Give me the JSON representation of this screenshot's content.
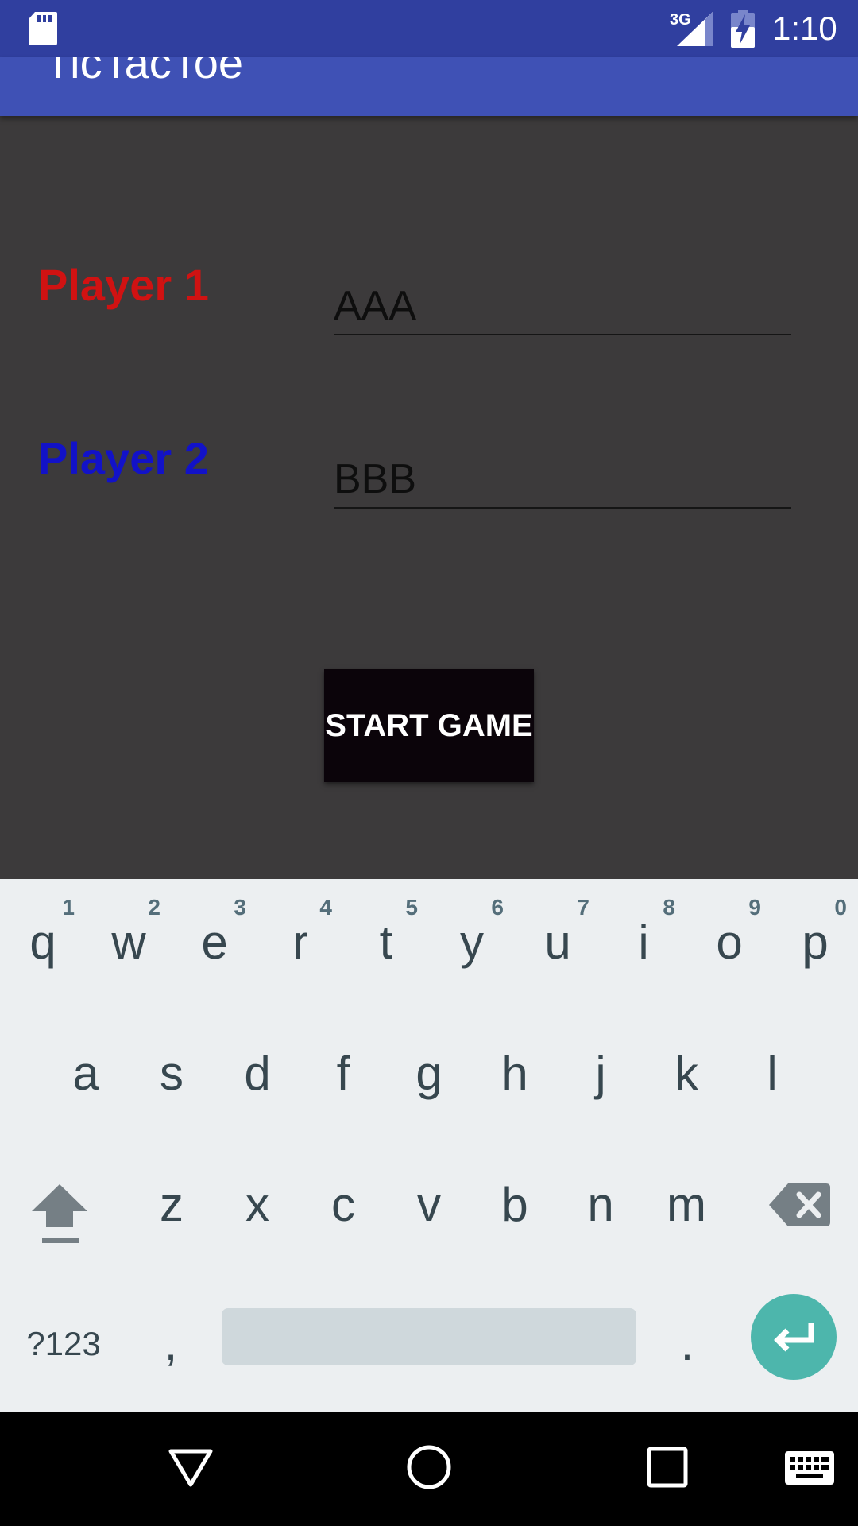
{
  "status_bar": {
    "network_type": "3G",
    "time": "1:10",
    "icons": [
      "sd-card-icon",
      "signal-icon",
      "battery-charging-icon"
    ]
  },
  "app_bar": {
    "title": "TicTacToe"
  },
  "form": {
    "player1": {
      "label": "Player 1",
      "value": "AAA",
      "label_color": "#D01212"
    },
    "player2": {
      "label": "Player 2",
      "value": "BBB",
      "label_color": "#1212C8"
    },
    "start_label": "START GAME"
  },
  "keyboard": {
    "row1": [
      {
        "key": "q",
        "hint": "1"
      },
      {
        "key": "w",
        "hint": "2"
      },
      {
        "key": "e",
        "hint": "3"
      },
      {
        "key": "r",
        "hint": "4"
      },
      {
        "key": "t",
        "hint": "5"
      },
      {
        "key": "y",
        "hint": "6"
      },
      {
        "key": "u",
        "hint": "7"
      },
      {
        "key": "i",
        "hint": "8"
      },
      {
        "key": "o",
        "hint": "9"
      },
      {
        "key": "p",
        "hint": "0"
      }
    ],
    "row2": [
      "a",
      "s",
      "d",
      "f",
      "g",
      "h",
      "j",
      "k",
      "l"
    ],
    "row3": [
      "z",
      "x",
      "c",
      "v",
      "b",
      "n",
      "m"
    ],
    "symbols_label": "?123",
    "comma": ",",
    "period": ".",
    "accent_color": "#4DB6AC"
  },
  "nav_bar": {
    "icons": [
      "back-icon",
      "home-icon",
      "recents-icon",
      "keyboard-icon"
    ]
  },
  "colors": {
    "status_bar": "#303F9F",
    "app_bar": "#3F51B5",
    "content_bg": "#3C3A3B",
    "button_bg": "#0B040A",
    "keyboard_bg": "#ECEFF1"
  }
}
